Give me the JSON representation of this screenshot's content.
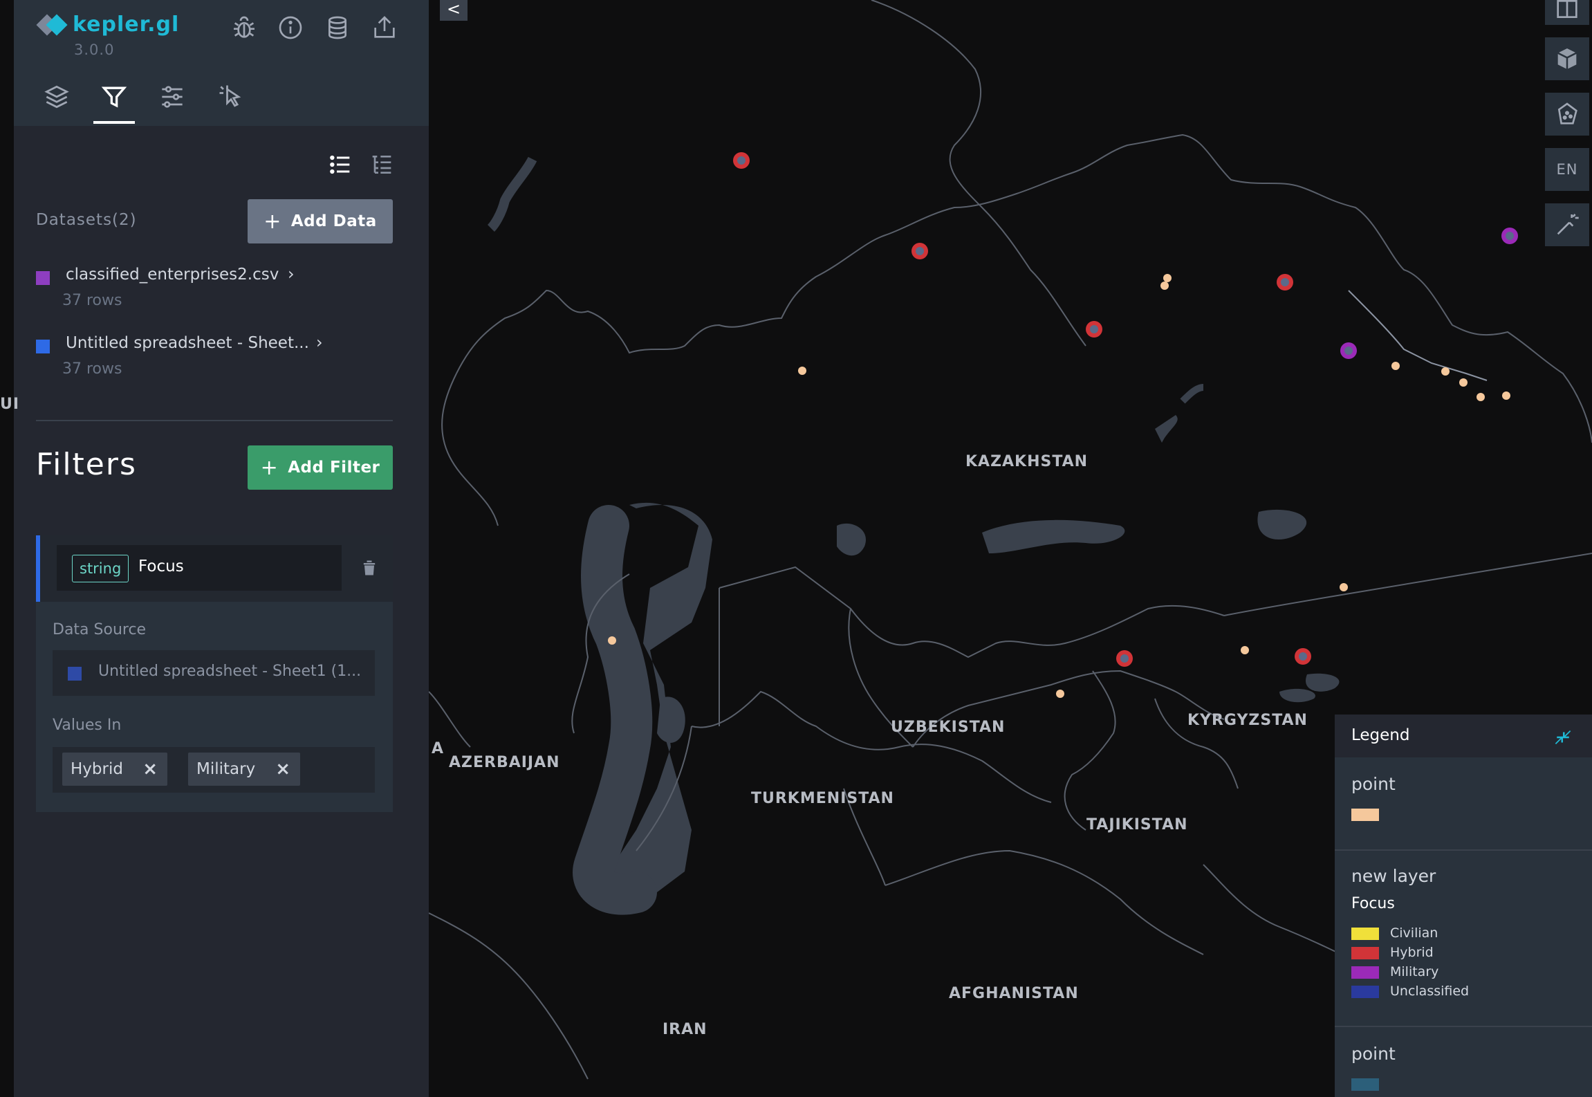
{
  "app": {
    "title": "kepler.gl",
    "version": "3.0.0",
    "brand_color": "#1fbad6"
  },
  "header_icons": [
    "bug-icon",
    "info-icon",
    "database-icon",
    "share-icon"
  ],
  "tabs": [
    {
      "name": "layers",
      "icon": "layers-icon",
      "active": false
    },
    {
      "name": "filters",
      "icon": "filter-icon",
      "active": true
    },
    {
      "name": "interactions",
      "icon": "sliders-icon",
      "active": false
    },
    {
      "name": "base-map",
      "icon": "cursor-icon",
      "active": false
    }
  ],
  "datasets": {
    "title": "Datasets(2)",
    "add_button": "Add Data",
    "items": [
      {
        "name": "classified_enterprises2.csv",
        "rows": "37 rows",
        "color": "#8e3ec0"
      },
      {
        "name": "Untitled spreadsheet - Sheet...",
        "rows": "37 rows",
        "color": "#2e6ae6"
      }
    ]
  },
  "filters": {
    "title": "Filters",
    "add_button": "Add Filter",
    "card": {
      "type_tag": "string",
      "field": "Focus",
      "data_source_label": "Data Source",
      "data_source": "Untitled spreadsheet - Sheet1 (1...",
      "values_label": "Values In",
      "values": [
        "Hybrid",
        "Military"
      ]
    }
  },
  "map": {
    "collapse_label": "<",
    "language": "EN",
    "countries": [
      "KAZAKHSTAN",
      "UZBEKISTAN",
      "KYRGYZSTAN",
      "TURKMENISTAN",
      "TAJIKISTAN",
      "AZERBAIJAN",
      "AFGHANISTAN",
      "IRAN",
      "A",
      "UI"
    ]
  },
  "legend": {
    "title": "Legend",
    "sections": [
      {
        "layer": "point",
        "color": "#f5c89c"
      },
      {
        "layer": "new layer",
        "field": "Focus",
        "items": [
          {
            "label": "Civilian",
            "color": "#f0e03a"
          },
          {
            "label": "Hybrid",
            "color": "#d13438"
          },
          {
            "label": "Military",
            "color": "#9b2ab8"
          },
          {
            "label": "Unclassified",
            "color": "#2a3a9e"
          }
        ]
      },
      {
        "layer": "point",
        "color": "#2c5f7a"
      }
    ]
  }
}
